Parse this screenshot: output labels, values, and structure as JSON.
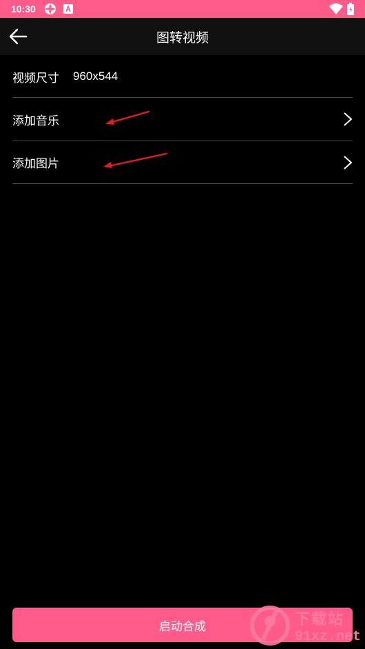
{
  "status_bar": {
    "time": "10:30",
    "icons": [
      "settings-app-icon",
      "a-notification-icon",
      "wifi-icon",
      "battery-icon"
    ]
  },
  "app_bar": {
    "title": "图转视频",
    "back_icon": "arrow-left-icon"
  },
  "settings": {
    "video_size_label": "视频尺寸",
    "video_size_value": "960x544",
    "add_music_label": "添加音乐",
    "add_image_label": "添加图片"
  },
  "actions": {
    "start_label": "启动合成"
  },
  "watermark": {
    "line1": "下载站",
    "line2": "91xz.net"
  },
  "colors": {
    "accent": "#ff5b8a",
    "annotation_arrow": "#e51c1c",
    "background": "#000000",
    "appbar": "#111111"
  }
}
